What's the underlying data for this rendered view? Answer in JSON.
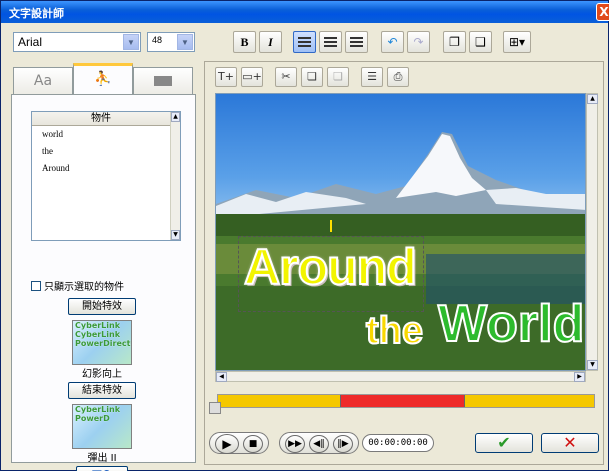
{
  "window": {
    "title": "文字設計師",
    "close_label": "X"
  },
  "toolbar": {
    "font_family": "Arial",
    "font_size": "48",
    "bold_label": "B",
    "italic_label": "I"
  },
  "left": {
    "tabs": [
      {
        "label": "Aa",
        "icon": "font-tab-icon"
      },
      {
        "label": "",
        "icon": "character-tab-icon"
      },
      {
        "label": "",
        "icon": "background-tab-icon"
      }
    ],
    "object_list": {
      "header": "物件",
      "items": [
        "world",
        "the",
        "Around"
      ]
    },
    "show_selected_checkbox": "只顯示選取的物件",
    "start_effect_button": "開始特效",
    "start_effect_preview_text": [
      "CyberLink",
      "CyberLink",
      "PowerDirector"
    ],
    "start_effect_name": "幻影向上",
    "end_effect_button": "結束特效",
    "end_effect_preview_text": [
      "CyberLink",
      "PowerD"
    ],
    "end_effect_name": "彈出 II"
  },
  "canvas": {
    "word_around": "Around",
    "word_the": "the",
    "word_world": "World"
  },
  "player": {
    "timecode": "00:00:00:00",
    "ok_label": "✔",
    "cancel_label": "✕"
  },
  "colors": {
    "title_bar": "#0054e3",
    "timeline_yellow": "#f5c800",
    "timeline_red": "#ee2a2a",
    "ok_green": "#2a9a2a",
    "cancel_red": "#d01010"
  }
}
